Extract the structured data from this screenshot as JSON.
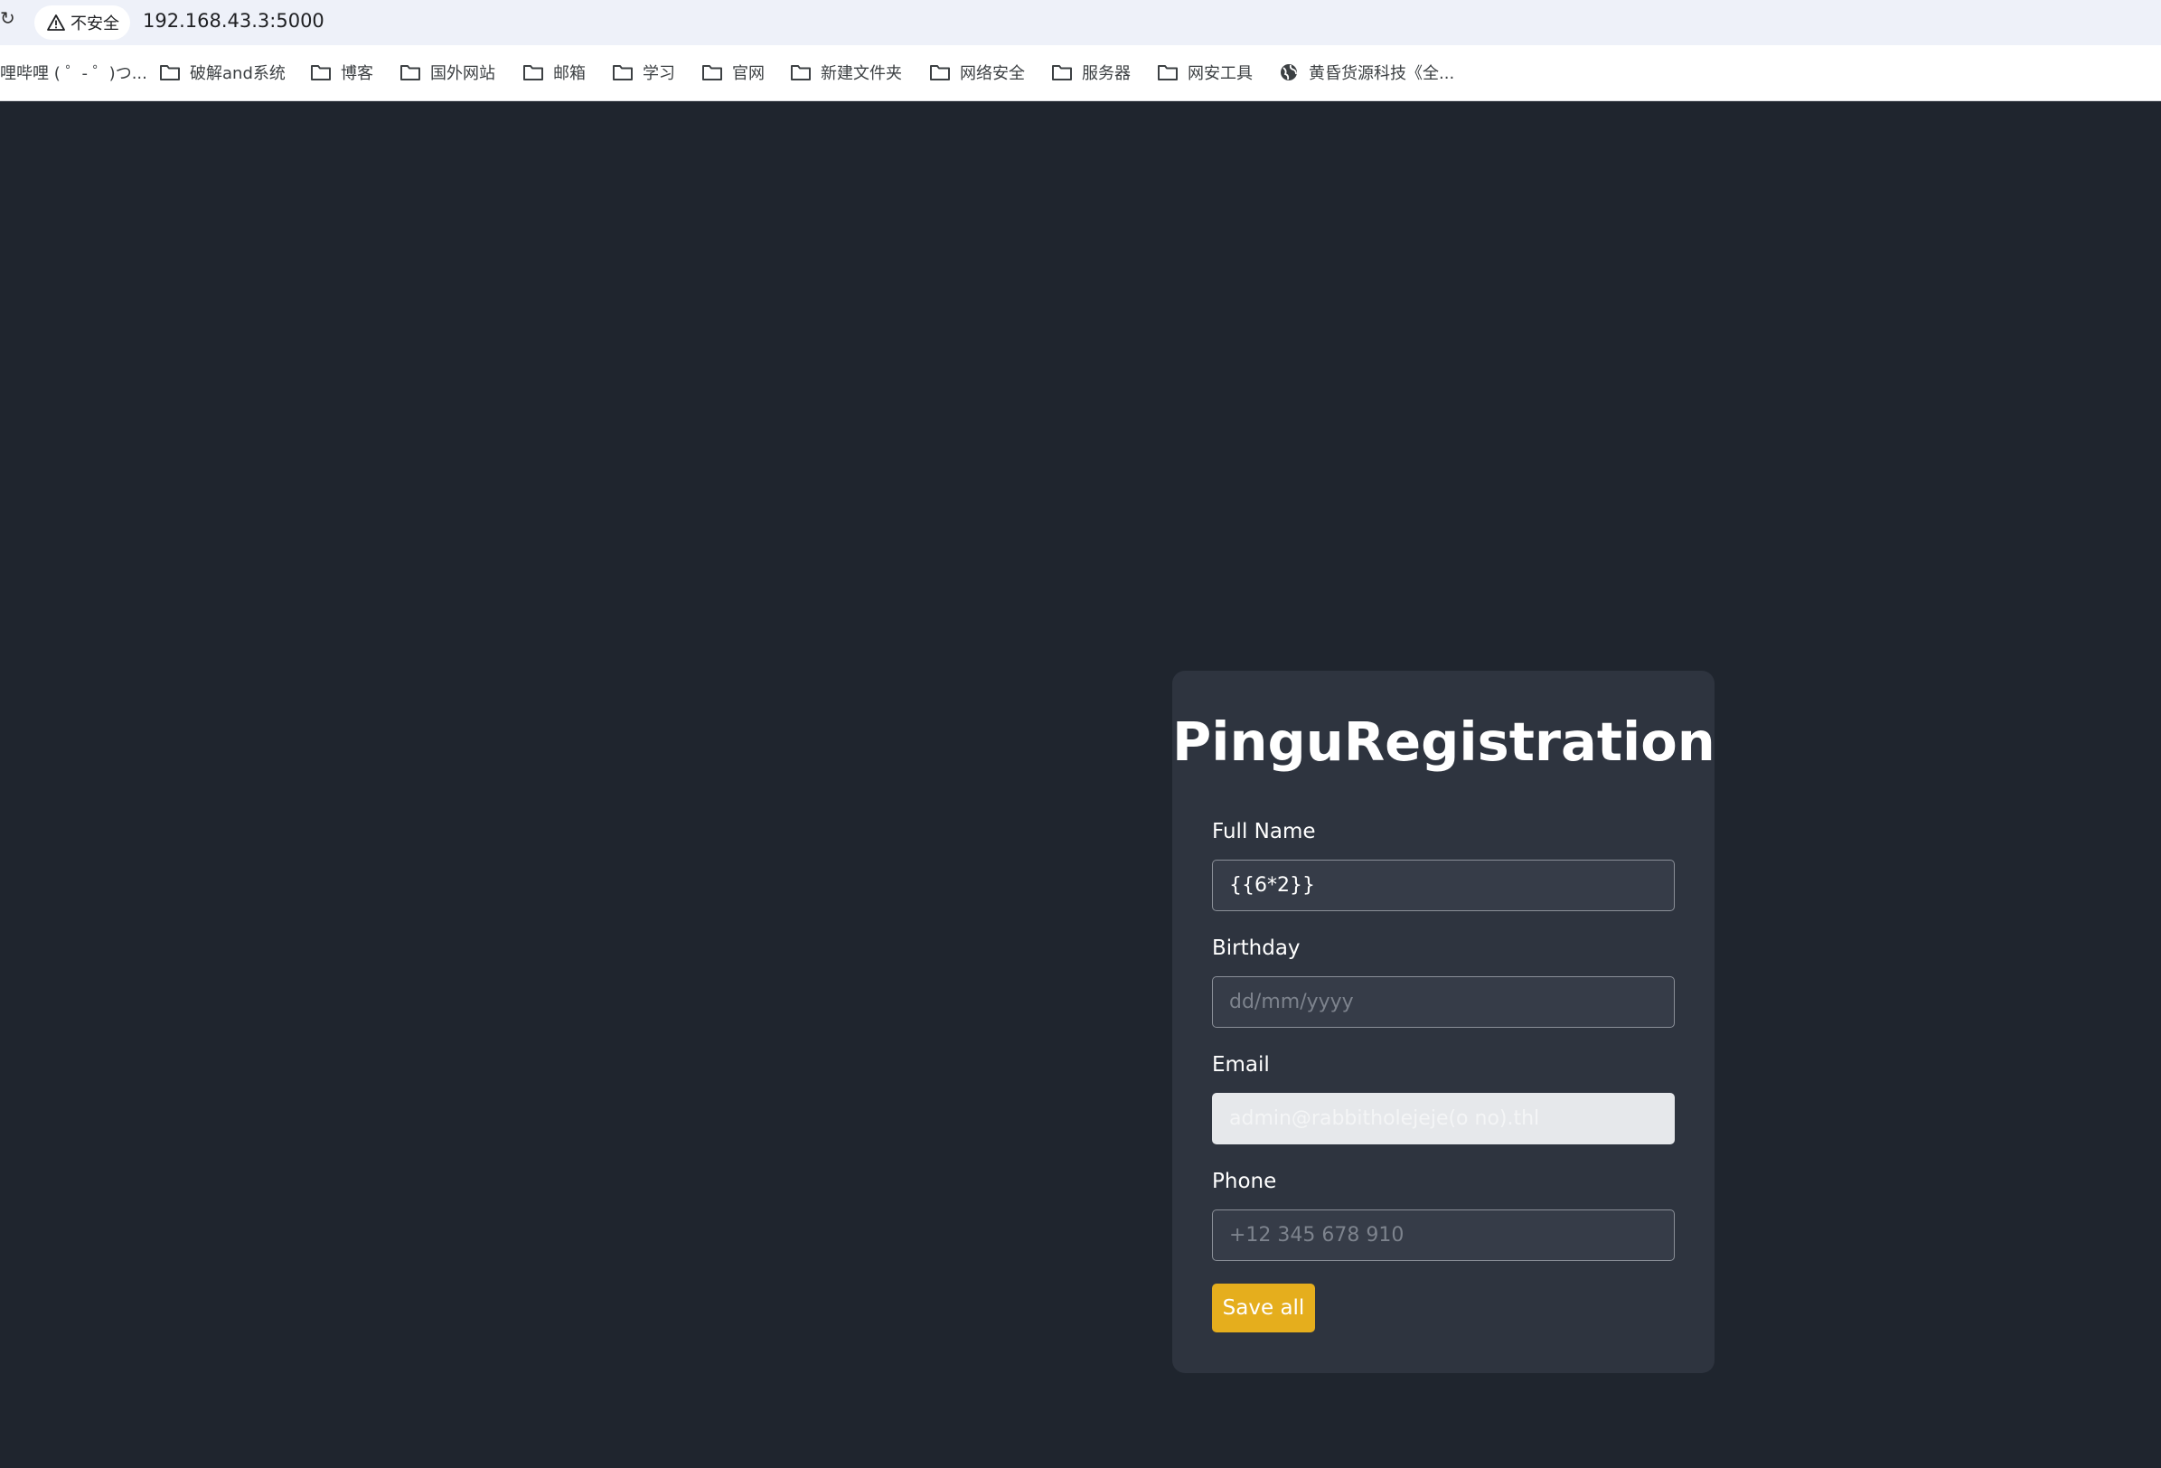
{
  "browser": {
    "security_label": "不安全",
    "url": "192.168.43.3:5000",
    "bookmarks": [
      {
        "label": "哩哔哩 ( ゜- ゜)つ...",
        "icon": "none"
      },
      {
        "label": "破解and系统",
        "icon": "folder-icon"
      },
      {
        "label": "博客",
        "icon": "folder-icon"
      },
      {
        "label": "国外网站",
        "icon": "folder-icon"
      },
      {
        "label": "邮箱",
        "icon": "folder-icon"
      },
      {
        "label": "学习",
        "icon": "folder-icon"
      },
      {
        "label": "官网",
        "icon": "folder-icon"
      },
      {
        "label": "新建文件夹",
        "icon": "folder-icon"
      },
      {
        "label": "网络安全",
        "icon": "folder-icon"
      },
      {
        "label": "服务器",
        "icon": "folder-icon"
      },
      {
        "label": "网安工具",
        "icon": "folder-icon"
      },
      {
        "label": "黄昏货源科技《全...",
        "icon": "globe-icon"
      }
    ]
  },
  "form": {
    "title": "PinguRegistration",
    "full_name": {
      "label": "Full Name",
      "value": "{{6*2}}"
    },
    "birthday": {
      "label": "Birthday",
      "placeholder": "dd/mm/yyyy"
    },
    "email": {
      "label": "Email",
      "placeholder": "admin@rabbitholejeje(o no).thl"
    },
    "phone": {
      "label": "Phone",
      "placeholder": "+12 345 678 910"
    },
    "save_label": "Save all"
  },
  "colors": {
    "page_background": "#1f252e",
    "card_background": "#2e343f",
    "button_accent": "#e5ae1d"
  }
}
